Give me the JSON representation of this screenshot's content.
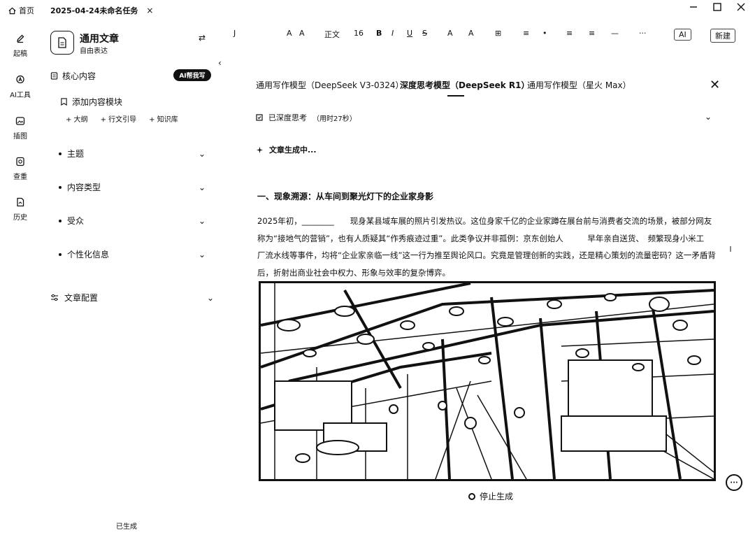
{
  "titlebar": {
    "home_label": "首页",
    "task_tab_label": "2025-04-24未命名任务",
    "close_tab": "×"
  },
  "rail": [
    {
      "label": "起稿",
      "icon": "pen-icon"
    },
    {
      "label": "AI工具",
      "icon": "ai-tool-icon"
    },
    {
      "label": "插图",
      "icon": "image-icon"
    },
    {
      "label": "查重",
      "icon": "check-icon"
    },
    {
      "label": "历史",
      "icon": "history-icon"
    }
  ],
  "left_panel": {
    "doc_title": "通用文章",
    "doc_subtitle": "自由表达",
    "core_label": "核心内容",
    "ai_write_label": "AI帮我写",
    "add_module_label": "添加内容模块",
    "chips": [
      "+ 大纲",
      "+ 行文引导",
      "+ 知识库"
    ],
    "sections": [
      "主题",
      "内容类型",
      "受众",
      "个性化信息"
    ],
    "article_config_label": "文章配置",
    "footer_text": "已生成"
  },
  "toolbar": {
    "items": [
      "J",
      "A",
      "A",
      "正文",
      "16",
      "B",
      "I",
      "U",
      "S",
      "A",
      "A",
      "⊞",
      "≡",
      "•",
      "≡",
      "≡",
      "—",
      "···",
      "AI",
      "新建"
    ]
  },
  "model_panel": {
    "tabs": [
      "通用写作模型（DeepSeek V3-0324）",
      "深度思考模型（DeepSeek R1）",
      "通用写作模型（星火 Max）"
    ],
    "active_tab_index": 1,
    "thinking_label": "已深度思考",
    "thinking_time": "（用时27秒）",
    "generating_label": "文章生成中...",
    "heading": "一、现象溯源：从车间到聚光灯下的企业家身影",
    "paragraph_lines": [
      "2025年初，________　　现身某县域车展的照片引发热议。这位身家千亿的企业家蹲在展台前与消费者交流的场景，被部分网友",
      "称为“接地气的营销”，也有人质疑其“作秀痕迹过重”。此类争议并非孤例：京东创始人　　　早年亲自送货、　频繁现身小米工",
      "厂流水线等事件，均将“企业家亲临一线”这一行为推至舆论风口。究竟是管理创新的实践，还是精心策划的流量密码？这一矛盾背",
      "后，折射出商业社会中权力、形象与效率的复杂博弈。"
    ],
    "stop_label": "停止生成"
  }
}
